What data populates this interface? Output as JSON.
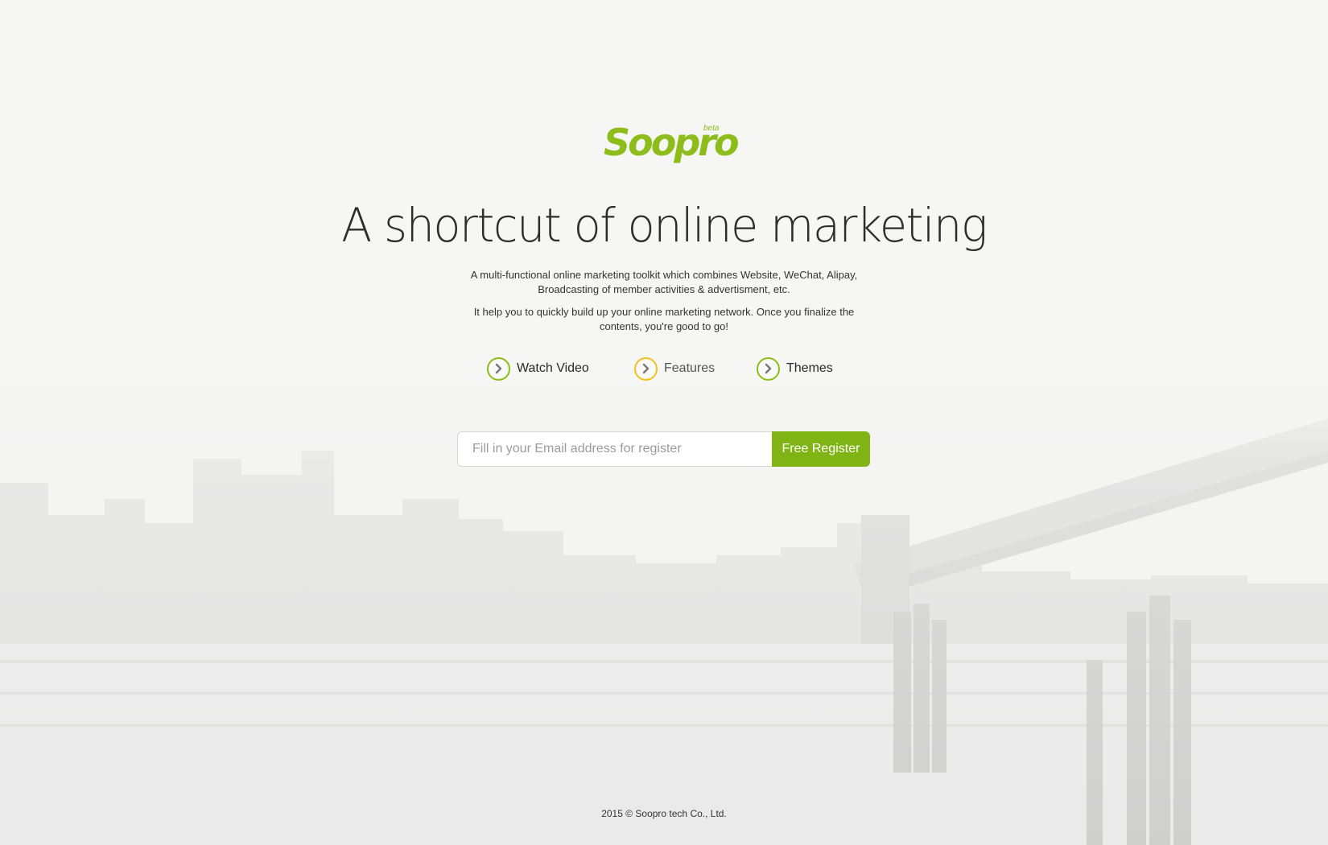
{
  "brand": {
    "logo_text": "Soopro",
    "beta_label": "beta",
    "accent_color": "#8cbd1a",
    "highlight_color": "#f3c11b"
  },
  "hero": {
    "headline": "A shortcut of online marketing",
    "description_1": "A multi-functional online marketing toolkit which combines Website, WeChat, Alipay, Broadcasting of member activities & advertisment, etc.",
    "description_2": "It help you to quickly build up your online marketing network. Once you finalize the contents, you're good to go!"
  },
  "actions": [
    {
      "label": "Watch Video",
      "icon": "chevron-right-icon",
      "ring_color": "#8cbd1a"
    },
    {
      "label": "Features",
      "icon": "chevron-right-icon",
      "ring_color": "#f3c11b"
    },
    {
      "label": "Themes",
      "icon": "chevron-right-icon",
      "ring_color": "#8cbd1a"
    }
  ],
  "signup": {
    "email_placeholder": "Fill in your Email address for register",
    "email_value": "",
    "register_label": "Free Register"
  },
  "footer": {
    "copyright": "2015 © Soopro tech Co., Ltd."
  }
}
